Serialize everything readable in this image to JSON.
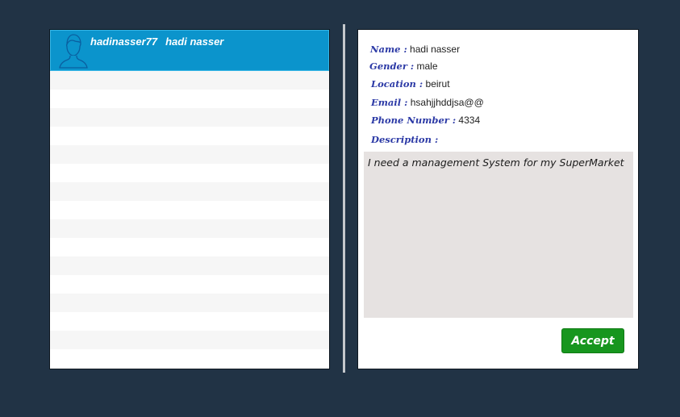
{
  "list": {
    "selected_item": {
      "username": "hadinasser77",
      "full_name": "hadi nasser",
      "avatar_icon": "user-avatar-icon"
    },
    "empty_row_count": 16
  },
  "details": {
    "name_label": "Name :",
    "name_value": "hadi nasser",
    "gender_label": "Gender :",
    "gender_value": "male",
    "location_label": "Location :",
    "location_value": "beirut",
    "email_label": "Email :",
    "email_value": "hsahjjhddjsa@@",
    "phone_label": "Phone Number :",
    "phone_value": "4334",
    "description_label": "Description :",
    "description_value": "I need a management System for my SuperMarket",
    "accept_label": "Accept"
  },
  "colors": {
    "background": "#213345",
    "selected_item": "#0b94cc",
    "label_text": "#2c3aa6",
    "accept_button": "#17961e",
    "description_bg": "#e6e2e1"
  }
}
